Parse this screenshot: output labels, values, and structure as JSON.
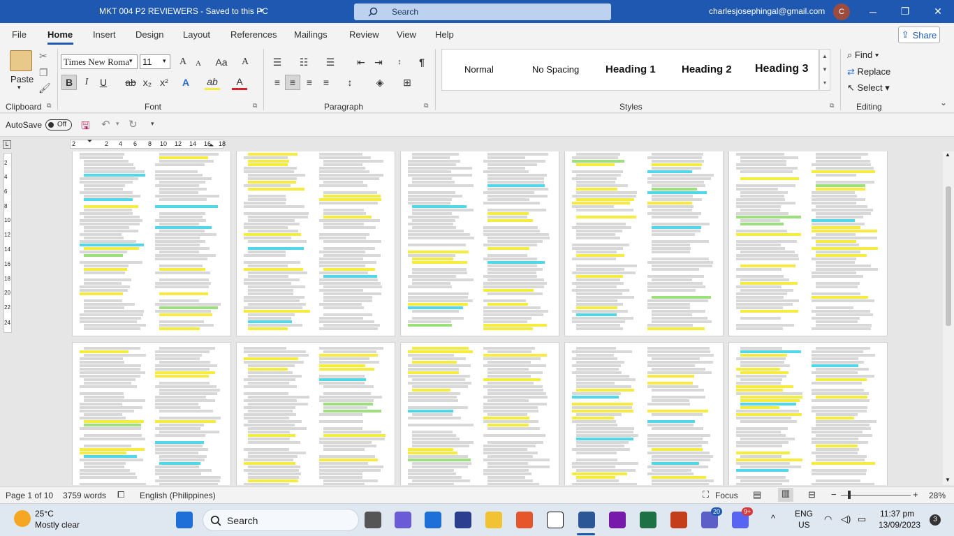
{
  "window": {
    "title": "MKT 004 P2 REVIEWERS  -  Saved to this PC",
    "search_placeholder": "Search",
    "account": "charlesjosephingal@gmail.com",
    "avatar_initial": "C"
  },
  "menu": {
    "items": [
      "File",
      "Home",
      "Insert",
      "Design",
      "Layout",
      "References",
      "Mailings",
      "Review",
      "View",
      "Help"
    ],
    "active": "Home",
    "share": "Share"
  },
  "ribbon": {
    "clipboard": {
      "paste": "Paste",
      "label": "Clipboard"
    },
    "font": {
      "family": "Times New Roma",
      "size": "11",
      "label": "Font",
      "bold": "B",
      "italic": "I",
      "underline": "U",
      "strike": "ab",
      "sub": "x₂",
      "sup": "x²",
      "grow": "A",
      "shrink": "A",
      "case": "Aa",
      "clear": "A",
      "effects": "A",
      "highlight": "ab",
      "color": "A"
    },
    "paragraph": {
      "label": "Paragraph"
    },
    "styles": {
      "items": [
        "Normal",
        "No Spacing",
        "Heading 1",
        "Heading 2",
        "Heading 3"
      ],
      "label": "Styles"
    },
    "editing": {
      "find": "Find",
      "replace": "Replace",
      "select": "Select",
      "label": "Editing"
    }
  },
  "quickbar": {
    "autosave": "AutoSave",
    "toggle": "Off"
  },
  "ruler": {
    "ticks": [
      "2",
      "2",
      "4",
      "6",
      "8",
      "10",
      "12",
      "14",
      "16",
      "18"
    ],
    "vticks": [
      "2",
      "4",
      "6",
      "8",
      "10",
      "12",
      "14",
      "16",
      "18",
      "20",
      "22",
      "24"
    ]
  },
  "status": {
    "page": "Page 1 of 10",
    "words": "3759 words",
    "language": "English (Philippines)",
    "focus": "Focus",
    "zoom": "28%"
  },
  "taskbar": {
    "weather_temp": "25°C",
    "weather_desc": "Mostly clear",
    "search": "Search",
    "badge_teams": "20",
    "badge_discord": "9+",
    "lang1": "ENG",
    "lang2": "US",
    "time": "11:37 pm",
    "date": "13/09/2023",
    "notif": "3"
  },
  "doc_pages": [
    {
      "heading": "Lesson 10: Product Development Strategies"
    },
    {
      "heading": "D. Investment in Research and Development"
    },
    {
      "heading": "Strategic Analysis"
    },
    {
      "heading": "Product Adoption Process"
    },
    {
      "heading": "Lesson 13: The Diffusion of Innovation Theory"
    },
    {
      "heading": "Lesson 11: Product Positioning"
    }
  ]
}
